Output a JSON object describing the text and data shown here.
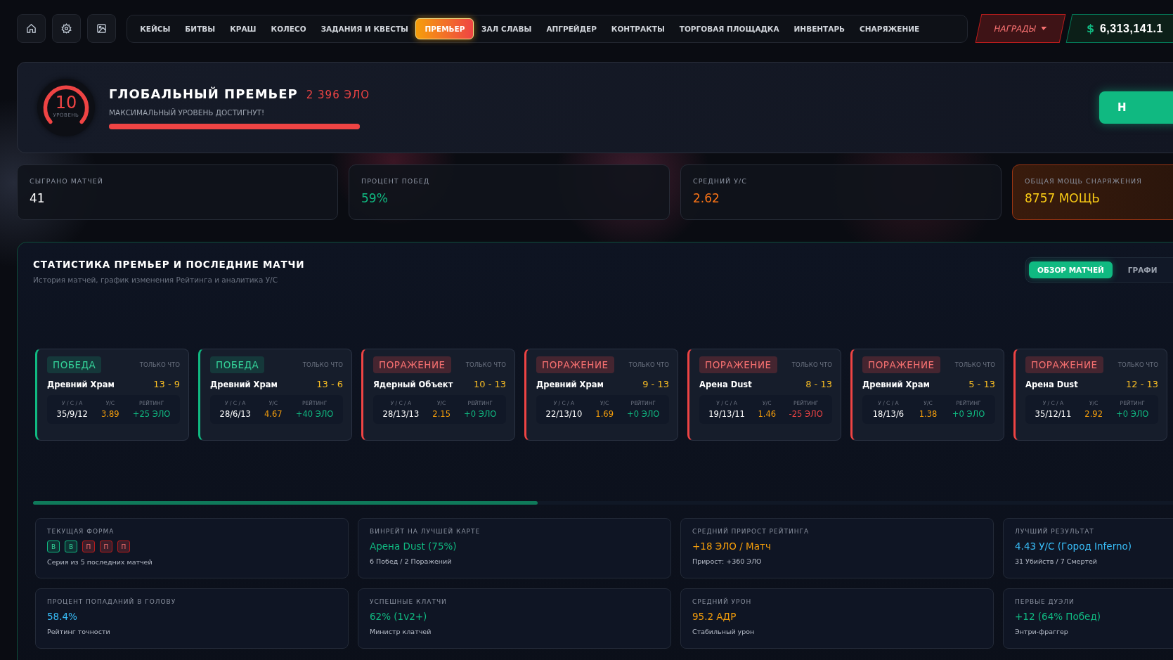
{
  "toolbar_icons": [
    {
      "kind": "home"
    },
    {
      "kind": "settings"
    },
    {
      "kind": "image"
    }
  ],
  "nav": [
    {
      "label": "КЕЙСЫ",
      "selected": false
    },
    {
      "label": "БИТВЫ",
      "selected": false
    },
    {
      "label": "КРАШ",
      "selected": false
    },
    {
      "label": "КОЛЕСО",
      "selected": false
    },
    {
      "label": "ЗАДАНИЯ И КВЕСТЫ",
      "selected": false
    },
    {
      "label": "ПРЕМЬЕР",
      "selected": true
    },
    {
      "label": "ЗАЛ СЛАВЫ",
      "selected": false
    },
    {
      "label": "АПГРЕЙДЕР",
      "selected": false
    },
    {
      "label": "КОНТРАКТЫ",
      "selected": false
    },
    {
      "label": "ТОРГОВАЯ ПЛОЩАДКА",
      "selected": false
    },
    {
      "label": "ИНВЕНТАРЬ",
      "selected": false
    },
    {
      "label": "СНАРЯЖЕНИЕ",
      "selected": false
    }
  ],
  "rewards_button": {
    "label": "НАГРАДЫ"
  },
  "balance": {
    "currency": "$",
    "amount": "6,313,141.1"
  },
  "premier": {
    "level": "10",
    "level_label": "УРОВЕНЬ",
    "title": "ГЛОБАЛЬНЫЙ ПРЕМЬЕР",
    "elo": "2 396 ЭЛО",
    "status": "МАКСИМАЛЬНЫЙ УРОВЕНЬ ДОСТИГНУТ!",
    "progress": {
      "level": 1
    },
    "action_button": "Н"
  },
  "stats": [
    {
      "label": "СЫГРАНО МАТЧЕЙ",
      "value": "41",
      "color": "#ffffff",
      "highlighted": false
    },
    {
      "label": "ПРОЦЕНТ ПОБЕД",
      "value": "59%",
      "color": "#10b981",
      "highlighted": false
    },
    {
      "label": "СРЕДНИЙ У/С",
      "value": "2.62",
      "color": "#f97316",
      "highlighted": false
    },
    {
      "label": "ОБЩАЯ МОЩЬ СНАРЯЖЕНИЯ",
      "value": "8757 МОЩЬ",
      "color": "#facc15",
      "highlighted": true
    }
  ],
  "section": {
    "title": "СТАТИСТИКА ПРЕМЬЕР И ПОСЛЕДНИЕ МАТЧИ",
    "subtitle": "История матчей, график изменения Рейтинга и аналитика У/С",
    "tabs": [
      {
        "label": "ОБЗОР МАТЧЕЙ",
        "selected": true
      },
      {
        "label": "ГРАФИ",
        "selected": false
      }
    ]
  },
  "matches": [
    {
      "result": "ПОБЕДА",
      "won": true,
      "time": "ТОЛЬКО ЧТО",
      "map": "Древний Храм",
      "score": "13 - 9",
      "kda_label": "У / С / А",
      "kda": "35/9/12",
      "kd_label": "У/С",
      "kd": "3.89",
      "rating_label": "РЕЙТИНГ",
      "rating": "+25 ЭЛО",
      "rating_negative": false
    },
    {
      "result": "ПОБЕДА",
      "won": true,
      "time": "ТОЛЬКО ЧТО",
      "map": "Древний Храм",
      "score": "13 - 6",
      "kda_label": "У / С / А",
      "kda": "28/6/13",
      "kd_label": "У/С",
      "kd": "4.67",
      "rating_label": "РЕЙТИНГ",
      "rating": "+40 ЭЛО",
      "rating_negative": false
    },
    {
      "result": "ПОРАЖЕНИЕ",
      "won": false,
      "time": "ТОЛЬКО ЧТО",
      "map": "Ядерный Объект",
      "score": "10 - 13",
      "kda_label": "У / С / А",
      "kda": "28/13/13",
      "kd_label": "У/С",
      "kd": "2.15",
      "rating_label": "РЕЙТИНГ",
      "rating": "+0 ЭЛО",
      "rating_negative": false
    },
    {
      "result": "ПОРАЖЕНИЕ",
      "won": false,
      "time": "ТОЛЬКО ЧТО",
      "map": "Древний Храм",
      "score": "9 - 13",
      "kda_label": "У / С / А",
      "kda": "22/13/10",
      "kd_label": "У/С",
      "kd": "1.69",
      "rating_label": "РЕЙТИНГ",
      "rating": "+0 ЭЛО",
      "rating_negative": false
    },
    {
      "result": "ПОРАЖЕНИЕ",
      "won": false,
      "time": "ТОЛЬКО ЧТО",
      "map": "Арена Dust",
      "score": "8 - 13",
      "kda_label": "У / С / А",
      "kda": "19/13/11",
      "kd_label": "У/С",
      "kd": "1.46",
      "rating_label": "РЕЙТИНГ",
      "rating": "-25 ЭЛО",
      "rating_negative": true
    },
    {
      "result": "ПОРАЖЕНИЕ",
      "won": false,
      "time": "ТОЛЬКО ЧТО",
      "map": "Древний Храм",
      "score": "5 - 13",
      "kda_label": "У / С / А",
      "kda": "18/13/6",
      "kd_label": "У/С",
      "kd": "1.38",
      "rating_label": "РЕЙТИНГ",
      "rating": "+0 ЭЛО",
      "rating_negative": false
    },
    {
      "result": "ПОРАЖЕНИЕ",
      "won": false,
      "time": "ТОЛЬКО ЧТО",
      "map": "Арена Dust",
      "score": "12 - 13",
      "kda_label": "У / С / А",
      "kda": "35/12/11",
      "kd_label": "У/С",
      "kd": "2.92",
      "rating_label": "РЕЙТИНГ",
      "rating": "+0 ЭЛО",
      "rating_negative": false
    }
  ],
  "insights": [
    {
      "kind": "form",
      "label": "ТЕКУЩАЯ ФОРМА",
      "form": [
        {
          "letter": "В",
          "won": true
        },
        {
          "letter": "В",
          "won": true
        },
        {
          "letter": "П",
          "won": false
        },
        {
          "letter": "П",
          "won": false
        },
        {
          "letter": "П",
          "won": false
        }
      ],
      "note": "Серия из 5 последних матчей"
    },
    {
      "kind": "metric",
      "label": "ВИНРЕЙТ НА ЛУЧШЕЙ КАРТЕ",
      "value": "Арена Dust (75%)",
      "color": "#10b981",
      "note": "6 Побед / 2 Поражений"
    },
    {
      "kind": "metric",
      "label": "СРЕДНИЙ ПРИРОСТ РЕЙТИНГА",
      "value": "+18 ЭЛО / Матч",
      "color": "#f59e0b",
      "note": "Прирост: +360 ЭЛО"
    },
    {
      "kind": "metric",
      "label": "ЛУЧШИЙ РЕЗУЛЬТАТ",
      "value": "4.43 У/С (Город Inferno)",
      "color": "#38bdf8",
      "note": "31 Убийств / 7 Смертей"
    },
    {
      "kind": "metric",
      "label": "ПРОЦЕНТ ПОПАДАНИЙ В ГОЛОВУ",
      "value": "58.4%",
      "color": "#38bdf8",
      "note": "Рейтинг точности"
    },
    {
      "kind": "metric",
      "label": "УСПЕШНЫЕ КЛАТЧИ",
      "value": "62% (1v2+)",
      "color": "#10b981",
      "note": "Министр клатчей"
    },
    {
      "kind": "metric",
      "label": "СРЕДНИЙ УРОН",
      "value": "95.2 АДР",
      "color": "#f59e0b",
      "note": "Стабильный урон"
    },
    {
      "kind": "metric",
      "label": "ПЕРВЫЕ ДУЭЛИ",
      "value": "+12 (64% Побед)",
      "color": "#10b981",
      "note": "Энтри-фраггер"
    }
  ]
}
